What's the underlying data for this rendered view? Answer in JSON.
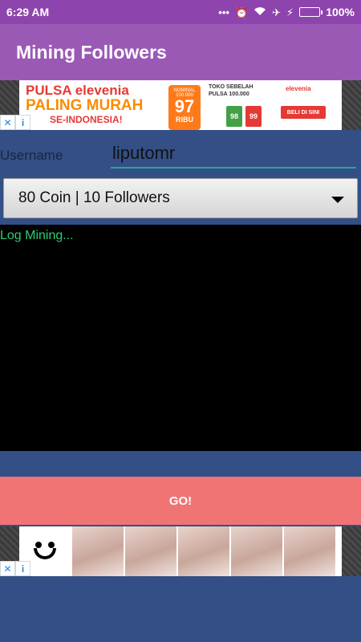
{
  "status_bar": {
    "time": "6:29 AM",
    "battery_text": "100%",
    "icons": [
      "more-icon",
      "alarm-icon",
      "wifi-icon",
      "airplane-icon",
      "charging-icon",
      "battery-icon"
    ],
    "battery_level": 1.0,
    "background": "#8e44ad"
  },
  "app_bar": {
    "title": "Mining Followers",
    "background": "#9b59b6"
  },
  "ad_top": {
    "line1": "PULSA elevenia",
    "line2": "PALING MURAH",
    "line3": "SE-INDONESIA!",
    "phone_label": "NOMINAL 100.000",
    "phone_value": "97",
    "phone_unit": "RIBU",
    "mid_text_1": "TOKO SEBELAH",
    "mid_text_2": "PULSA 100.000",
    "box_left": "98",
    "box_right": "99",
    "brand": "elevenia",
    "cta": "BELI DI SINI",
    "close_glyph": "✕",
    "info_glyph": "i"
  },
  "form": {
    "username_label": "Username",
    "username_value": "liputomr",
    "selected_option": "80 Coin | 10 Followers",
    "accent_color": "#26a69a"
  },
  "log": {
    "text": "Log Mining...",
    "text_color": "#2ecc71",
    "background": "#000000"
  },
  "go_button": {
    "label": "GO!",
    "background": "#f07474"
  },
  "ad_bottom": {
    "close_glyph": "✕",
    "info_glyph": "i"
  },
  "page_background": "#344f86"
}
